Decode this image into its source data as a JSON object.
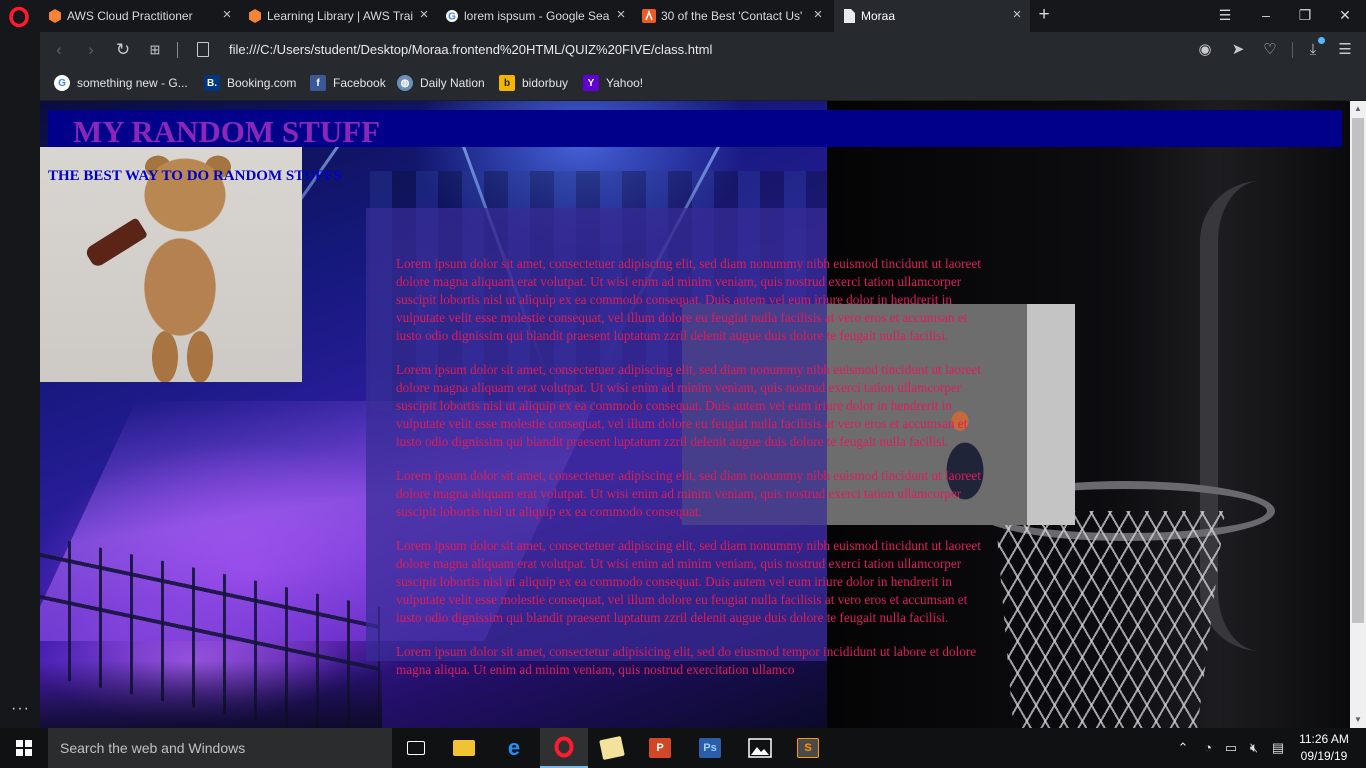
{
  "browser": {
    "tabs": [
      {
        "label": "AWS Cloud Practitioner",
        "icon": "aws-hexagon-icon",
        "color": "#f58534"
      },
      {
        "label": "Learning Library | AWS Trai",
        "icon": "aws-hexagon-icon",
        "color": "#f58534"
      },
      {
        "label": "lorem ispsum - Google Sea",
        "icon": "google-icon",
        "color": "#4285f4"
      },
      {
        "label": "30 of the Best 'Contact Us'",
        "icon": "site-favicon-icon",
        "color": "#ee5a24"
      },
      {
        "label": "Moraa",
        "icon": "page-icon",
        "color": "#ffffff",
        "active": true
      }
    ],
    "address_url": "file:///C:/Users/student/Desktop/Moraa.frontend%20HTML/QUIZ%20FIVE/class.html",
    "bookmarks": [
      {
        "label": "something new - G...",
        "icon": "google-icon",
        "color": "#ffffff"
      },
      {
        "label": "Booking.com",
        "icon": "booking-icon",
        "color": "#003580"
      },
      {
        "label": "Facebook",
        "icon": "facebook-icon",
        "color": "#3b5998"
      },
      {
        "label": "Daily Nation",
        "icon": "globe-icon",
        "color": "#6b8fb8"
      },
      {
        "label": "bidorbuy",
        "icon": "bidorbuy-icon",
        "color": "#f4b400"
      },
      {
        "label": "Yahoo!",
        "icon": "yahoo-icon",
        "color": "#5f01d1"
      }
    ],
    "accent": "#ff1b2d"
  },
  "page": {
    "title": "MY RANDOM STUFF",
    "subtitle": "THE BEST WAY TO DO RANDOM STUFFS",
    "title_color": "#8b26b8",
    "header_bg": "#00008b",
    "subtitle_color": "#0000cd",
    "text_color": "#dc1e5a",
    "paragraphs": [
      "Lorem ipsum dolor sit amet, consectetuer adipiscing elit, sed diam nonummy nibh euismod tincidunt ut laoreet dolore magna aliquam erat volutpat. Ut wisi enim ad minim veniam, quis nostrud exerci tation ullamcorper suscipit lobortis nisl ut aliquip ex ea commodo consequat. Duis autem vel eum iriure dolor in hendrerit in vulputate velit esse molestie consequat, vel illum dolore eu feugiat nulla facilisis at vero eros et accumsan et iusto odio dignissim qui blandit praesent luptatum zzril delenit augue duis dolore te feugait nulla facilisi.",
      "Lorem ipsum dolor sit amet, consectetuer adipiscing elit, sed diam nonummy nibh euismod tincidunt ut laoreet dolore magna aliquam erat volutpat. Ut wisi enim ad minim veniam, quis nostrud exerci tation ullamcorper suscipit lobortis nisl ut aliquip ex ea commodo consequat. Duis autem vel eum iriure dolor in hendrerit in vulputate velit esse molestie consequat, vel illum dolore eu feugiat nulla facilisis at vero eros et accumsan et iusto odio dignissim qui blandit praesent luptatum zzril delenit augue duis dolore te feugait nulla facilisi.",
      "Lorem ipsum dolor sit amet, consectetuer adipiscing elit, sed diam nonummy nibh euismod tincidunt ut laoreet dolore magna aliquam erat volutpat. Ut wisi enim ad minim veniam, quis nostrud exerci tation ullamcorper suscipit lobortis nisl ut aliquip ex ea commodo consequat.",
      "Lorem ipsum dolor sit amet, consectetuer adipiscing elit, sed diam nonummy nibh euismod tincidunt ut laoreet dolore magna aliquam erat volutpat. Ut wisi enim ad minim veniam, quis nostrud exerci tation ullamcorper suscipit lobortis nisl ut aliquip ex ea commodo consequat. Duis autem vel eum iriure dolor in hendrerit in vulputate velit esse molestie consequat, vel illum dolore eu feugiat nulla facilisis at vero eros et accumsan et iusto odio dignissim qui blandit praesent luptatum zzril delenit augue duis dolore te feugait nulla facilisi.",
      "Lorem ipsum dolor sit amet, consectetur adipisicing elit, sed do eiusmod tempor incididunt ut labore et dolore magna aliqua. Ut enim ad minim veniam, quis nostrud exercitation ullamco"
    ]
  },
  "taskbar": {
    "search_placeholder": "Search the web and Windows",
    "apps": [
      {
        "name": "task-view-icon",
        "color": "#ffffff"
      },
      {
        "name": "file-explorer-icon",
        "color": "#f1c232"
      },
      {
        "name": "edge-icon",
        "color": "#1e90ff"
      },
      {
        "name": "opera-icon",
        "color": "#ff1b2d",
        "active": true
      },
      {
        "name": "photos-icon",
        "color": "#f2e29b"
      },
      {
        "name": "powerpoint-icon",
        "color": "#d24726"
      },
      {
        "name": "photoshop-icon",
        "color": "#2c5da8"
      },
      {
        "name": "photo-viewer-icon",
        "color": "#ffffff"
      },
      {
        "name": "sublime-text-icon",
        "color": "#ff9800"
      }
    ],
    "time": "11:26 AM",
    "date": "09/19/19"
  }
}
